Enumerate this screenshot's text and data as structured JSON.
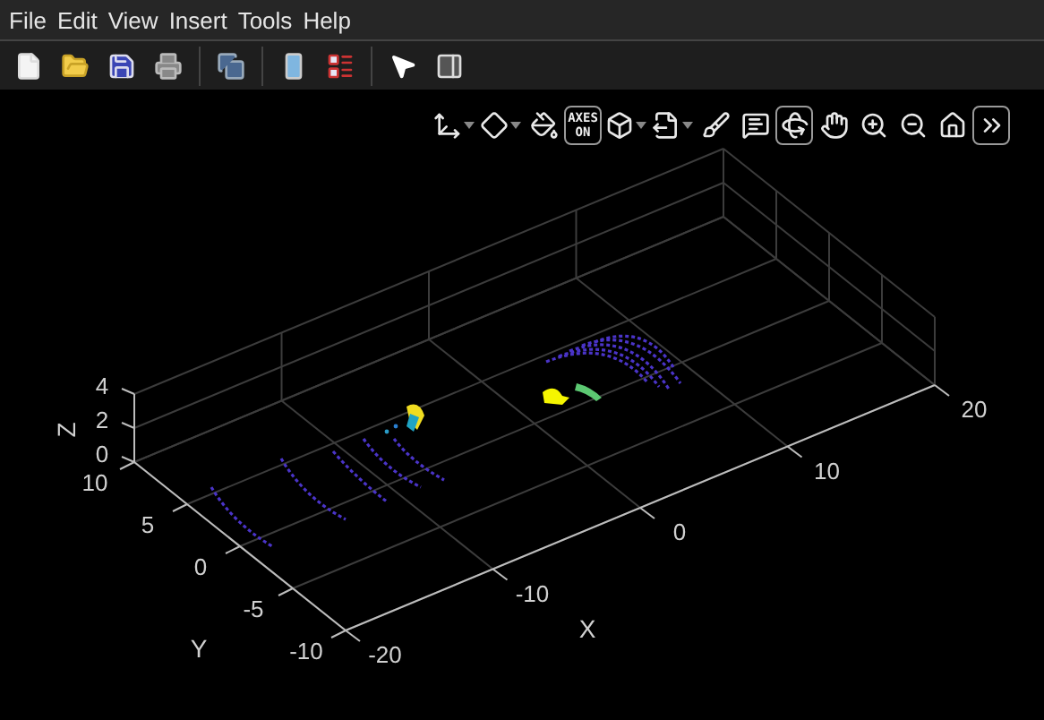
{
  "menu": [
    {
      "label": "File"
    },
    {
      "label": "Edit"
    },
    {
      "label": "View"
    },
    {
      "label": "Insert"
    },
    {
      "label": "Tools"
    },
    {
      "label": "Help"
    }
  ],
  "figure_toolbar": [
    {
      "kind": "new"
    },
    {
      "kind": "open"
    },
    {
      "kind": "save"
    },
    {
      "kind": "print"
    },
    {
      "kind": "separator"
    },
    {
      "kind": "link"
    },
    {
      "kind": "separator"
    },
    {
      "kind": "colorbar"
    },
    {
      "kind": "legend"
    },
    {
      "kind": "separator"
    },
    {
      "kind": "pointer"
    },
    {
      "kind": "inspector"
    }
  ],
  "axes_toolbar": [
    {
      "kind": "axes",
      "dropdown": true,
      "selected": false
    },
    {
      "kind": "datatip",
      "dropdown": true,
      "selected": false
    },
    {
      "kind": "fill",
      "dropdown": false,
      "selected": false
    },
    {
      "kind": "toggle",
      "label": [
        "AXES",
        "ON"
      ],
      "selected": true
    },
    {
      "kind": "view",
      "dropdown": true,
      "selected": false
    },
    {
      "kind": "export",
      "dropdown": true,
      "selected": false
    },
    {
      "kind": "brush",
      "dropdown": false,
      "selected": false
    },
    {
      "kind": "note",
      "dropdown": false,
      "selected": false
    },
    {
      "kind": "rotate",
      "dropdown": false,
      "selected": true
    },
    {
      "kind": "pan",
      "dropdown": false,
      "selected": false
    },
    {
      "kind": "zoomin",
      "dropdown": false,
      "selected": false
    },
    {
      "kind": "zoomout",
      "dropdown": false,
      "selected": false
    },
    {
      "kind": "home",
      "dropdown": false,
      "selected": false
    },
    {
      "kind": "more",
      "dropdown": false,
      "selected": true
    }
  ],
  "plot": {
    "x_label": "X",
    "y_label": "Y",
    "z_label": "Z",
    "x_ticks": [
      "-20",
      "-10",
      "0",
      "10",
      "20"
    ],
    "y_ticks": [
      "-10",
      "-5",
      "0",
      "5",
      "10"
    ],
    "z_ticks": [
      "4",
      "2",
      "0"
    ]
  }
}
